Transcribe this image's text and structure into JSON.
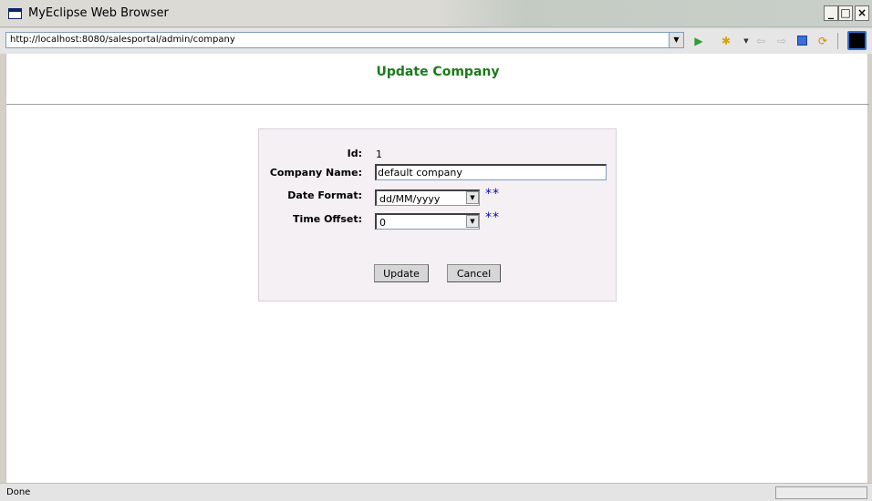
{
  "window": {
    "title": "MyEclipse Web Browser",
    "minimize_label": "_",
    "maximize_label": "□",
    "close_label": "×"
  },
  "toolbar": {
    "url": "http://localhost:8080/salesportal/admin/company",
    "icons": [
      "go-icon",
      "bookmark-icon",
      "back-icon",
      "forward-icon",
      "stop-icon",
      "refresh-icon",
      "view-icon"
    ]
  },
  "page": {
    "title": "Update Company",
    "title_color": "#1c7a1c"
  },
  "form": {
    "id_label": "Id:",
    "id_value": "1",
    "name_label": "Company Name:",
    "name_value": "default company",
    "date_label": "Date Format:",
    "date_value": "dd/MM/yyyy",
    "time_label": "Time Offset:",
    "time_value": "0",
    "required_marker": "**",
    "update_label": "Update",
    "cancel_label": "Cancel"
  },
  "status": {
    "text": "Done"
  }
}
